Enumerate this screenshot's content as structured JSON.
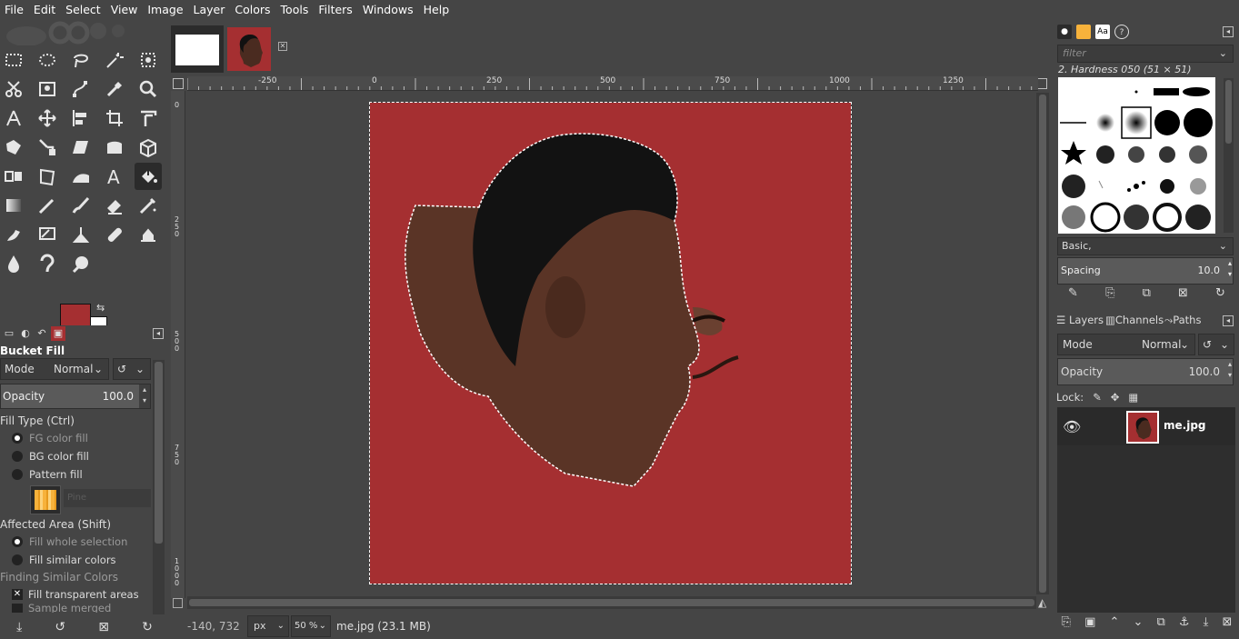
{
  "menu": [
    "File",
    "Edit",
    "Select",
    "View",
    "Image",
    "Layer",
    "Colors",
    "Tools",
    "Filters",
    "Windows",
    "Help"
  ],
  "colors": {
    "foreground": "#a52f31",
    "background": "#ffffff",
    "canvas_fill": "#a52f31"
  },
  "tool_options": {
    "title": "Bucket Fill",
    "mode_label": "Mode",
    "mode_value": "Normal",
    "opacity_label": "Opacity",
    "opacity_value": "100.0",
    "fill_type_label": "Fill Type  (Ctrl)",
    "fill_fg": "FG color fill",
    "fill_bg": "BG color fill",
    "fill_pattern": "Pattern fill",
    "pattern_name": "Pine",
    "affected_label": "Affected Area  (Shift)",
    "area_whole": "Fill whole selection",
    "area_similar": "Fill similar colors",
    "finding_label": "Finding Similar Colors",
    "fill_transparent": "Fill transparent areas",
    "sample_merged": "Sample merged"
  },
  "rulers": {
    "horizontal": [
      "-250",
      "0",
      "250",
      "500",
      "750",
      "1000",
      "1250"
    ],
    "vertical": [
      "0",
      "250",
      "500",
      "750",
      "1000"
    ]
  },
  "status": {
    "coords": "-140, 732",
    "unit": "px",
    "zoom": "50 %",
    "message": "me.jpg (23.1 MB)"
  },
  "brushes": {
    "filter_placeholder": "filter",
    "selected_name": "2. Hardness 050 (51 × 51)",
    "preset": "Basic,",
    "spacing_label": "Spacing",
    "spacing_value": "10.0"
  },
  "layers": {
    "tab_layers": "Layers",
    "tab_channels": "Channels",
    "tab_paths": "Paths",
    "mode_label": "Mode",
    "mode_value": "Normal",
    "opacity_label": "Opacity",
    "opacity_value": "100.0",
    "lock_label": "Lock:",
    "items": [
      {
        "name": "me.jpg"
      }
    ]
  }
}
